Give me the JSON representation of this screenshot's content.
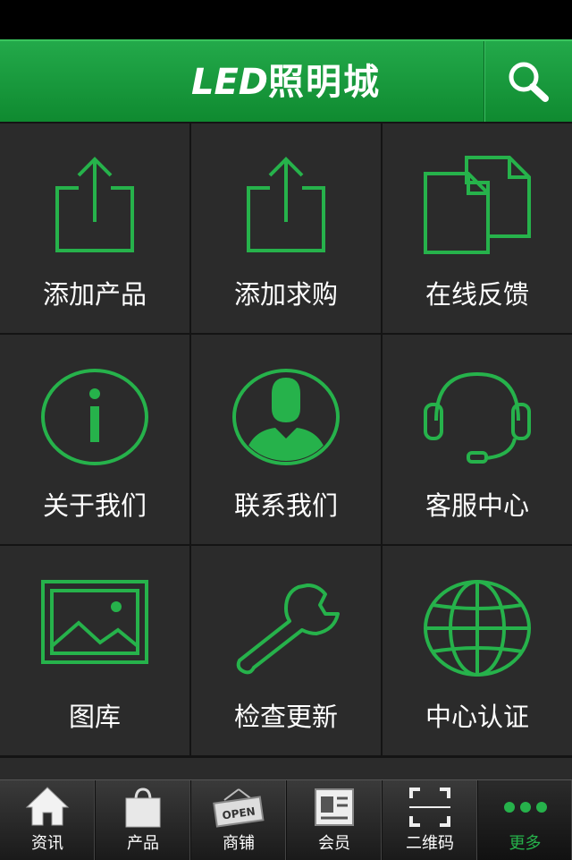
{
  "header": {
    "logo_latin": "LED",
    "logo_cn": "照明城",
    "search_icon": "search-icon"
  },
  "accent_color": "#26b24b",
  "grid": [
    {
      "label": "添加产品",
      "icon": "upload-icon"
    },
    {
      "label": "添加求购",
      "icon": "upload-icon"
    },
    {
      "label": "在线反馈",
      "icon": "documents-icon"
    },
    {
      "label": "关于我们",
      "icon": "info-icon"
    },
    {
      "label": "联系我们",
      "icon": "person-icon"
    },
    {
      "label": "客服中心",
      "icon": "headset-icon"
    },
    {
      "label": "图库",
      "icon": "image-icon"
    },
    {
      "label": "检查更新",
      "icon": "wrench-icon"
    },
    {
      "label": "中心认证",
      "icon": "globe-icon"
    }
  ],
  "tabbar": [
    {
      "label": "资讯",
      "icon": "home-icon"
    },
    {
      "label": "产品",
      "icon": "shopping-bag-icon"
    },
    {
      "label": "商铺",
      "icon": "open-sign-icon",
      "sign_text": "OPEN"
    },
    {
      "label": "会员",
      "icon": "id-card-icon"
    },
    {
      "label": "二维码",
      "icon": "qr-scan-icon"
    },
    {
      "label": "更多",
      "icon": "more-dots-icon",
      "active": true
    }
  ]
}
